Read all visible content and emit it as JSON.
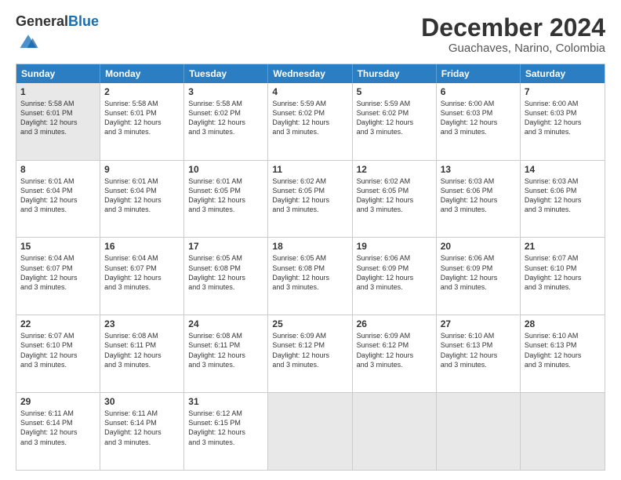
{
  "logo": {
    "general": "General",
    "blue": "Blue"
  },
  "header": {
    "month": "December 2024",
    "location": "Guachaves, Narino, Colombia"
  },
  "weekdays": [
    "Sunday",
    "Monday",
    "Tuesday",
    "Wednesday",
    "Thursday",
    "Friday",
    "Saturday"
  ],
  "rows": [
    [
      {
        "day": "1",
        "text": "Sunrise: 5:58 AM\nSunset: 6:01 PM\nDaylight: 12 hours\nand 3 minutes."
      },
      {
        "day": "2",
        "text": "Sunrise: 5:58 AM\nSunset: 6:01 PM\nDaylight: 12 hours\nand 3 minutes."
      },
      {
        "day": "3",
        "text": "Sunrise: 5:58 AM\nSunset: 6:02 PM\nDaylight: 12 hours\nand 3 minutes."
      },
      {
        "day": "4",
        "text": "Sunrise: 5:59 AM\nSunset: 6:02 PM\nDaylight: 12 hours\nand 3 minutes."
      },
      {
        "day": "5",
        "text": "Sunrise: 5:59 AM\nSunset: 6:02 PM\nDaylight: 12 hours\nand 3 minutes."
      },
      {
        "day": "6",
        "text": "Sunrise: 6:00 AM\nSunset: 6:03 PM\nDaylight: 12 hours\nand 3 minutes."
      },
      {
        "day": "7",
        "text": "Sunrise: 6:00 AM\nSunset: 6:03 PM\nDaylight: 12 hours\nand 3 minutes."
      }
    ],
    [
      {
        "day": "8",
        "text": "Sunrise: 6:01 AM\nSunset: 6:04 PM\nDaylight: 12 hours\nand 3 minutes."
      },
      {
        "day": "9",
        "text": "Sunrise: 6:01 AM\nSunset: 6:04 PM\nDaylight: 12 hours\nand 3 minutes."
      },
      {
        "day": "10",
        "text": "Sunrise: 6:01 AM\nSunset: 6:05 PM\nDaylight: 12 hours\nand 3 minutes."
      },
      {
        "day": "11",
        "text": "Sunrise: 6:02 AM\nSunset: 6:05 PM\nDaylight: 12 hours\nand 3 minutes."
      },
      {
        "day": "12",
        "text": "Sunrise: 6:02 AM\nSunset: 6:05 PM\nDaylight: 12 hours\nand 3 minutes."
      },
      {
        "day": "13",
        "text": "Sunrise: 6:03 AM\nSunset: 6:06 PM\nDaylight: 12 hours\nand 3 minutes."
      },
      {
        "day": "14",
        "text": "Sunrise: 6:03 AM\nSunset: 6:06 PM\nDaylight: 12 hours\nand 3 minutes."
      }
    ],
    [
      {
        "day": "15",
        "text": "Sunrise: 6:04 AM\nSunset: 6:07 PM\nDaylight: 12 hours\nand 3 minutes."
      },
      {
        "day": "16",
        "text": "Sunrise: 6:04 AM\nSunset: 6:07 PM\nDaylight: 12 hours\nand 3 minutes."
      },
      {
        "day": "17",
        "text": "Sunrise: 6:05 AM\nSunset: 6:08 PM\nDaylight: 12 hours\nand 3 minutes."
      },
      {
        "day": "18",
        "text": "Sunrise: 6:05 AM\nSunset: 6:08 PM\nDaylight: 12 hours\nand 3 minutes."
      },
      {
        "day": "19",
        "text": "Sunrise: 6:06 AM\nSunset: 6:09 PM\nDaylight: 12 hours\nand 3 minutes."
      },
      {
        "day": "20",
        "text": "Sunrise: 6:06 AM\nSunset: 6:09 PM\nDaylight: 12 hours\nand 3 minutes."
      },
      {
        "day": "21",
        "text": "Sunrise: 6:07 AM\nSunset: 6:10 PM\nDaylight: 12 hours\nand 3 minutes."
      }
    ],
    [
      {
        "day": "22",
        "text": "Sunrise: 6:07 AM\nSunset: 6:10 PM\nDaylight: 12 hours\nand 3 minutes."
      },
      {
        "day": "23",
        "text": "Sunrise: 6:08 AM\nSunset: 6:11 PM\nDaylight: 12 hours\nand 3 minutes."
      },
      {
        "day": "24",
        "text": "Sunrise: 6:08 AM\nSunset: 6:11 PM\nDaylight: 12 hours\nand 3 minutes."
      },
      {
        "day": "25",
        "text": "Sunrise: 6:09 AM\nSunset: 6:12 PM\nDaylight: 12 hours\nand 3 minutes."
      },
      {
        "day": "26",
        "text": "Sunrise: 6:09 AM\nSunset: 6:12 PM\nDaylight: 12 hours\nand 3 minutes."
      },
      {
        "day": "27",
        "text": "Sunrise: 6:10 AM\nSunset: 6:13 PM\nDaylight: 12 hours\nand 3 minutes."
      },
      {
        "day": "28",
        "text": "Sunrise: 6:10 AM\nSunset: 6:13 PM\nDaylight: 12 hours\nand 3 minutes."
      }
    ],
    [
      {
        "day": "29",
        "text": "Sunrise: 6:11 AM\nSunset: 6:14 PM\nDaylight: 12 hours\nand 3 minutes."
      },
      {
        "day": "30",
        "text": "Sunrise: 6:11 AM\nSunset: 6:14 PM\nDaylight: 12 hours\nand 3 minutes."
      },
      {
        "day": "31",
        "text": "Sunrise: 6:12 AM\nSunset: 6:15 PM\nDaylight: 12 hours\nand 3 minutes."
      },
      {
        "day": "",
        "text": ""
      },
      {
        "day": "",
        "text": ""
      },
      {
        "day": "",
        "text": ""
      },
      {
        "day": "",
        "text": ""
      }
    ]
  ]
}
